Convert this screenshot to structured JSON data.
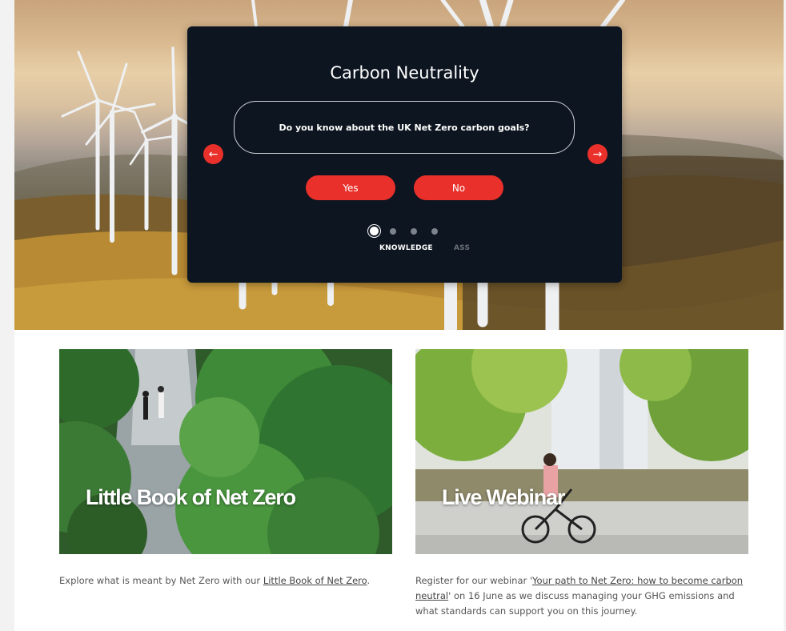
{
  "hero": {
    "modal": {
      "title": "Carbon Neutrality",
      "question": "Do you know about the UK Net Zero carbon goals?",
      "yes_label": "Yes",
      "no_label": "No",
      "prev_icon": "arrow-left-icon",
      "next_icon": "arrow-right-icon",
      "step_count": 4,
      "active_step": 1,
      "step_label_current": "KNOWLEDGE",
      "step_label_next": "ASS"
    }
  },
  "cards": [
    {
      "title": "Little Book of Net Zero",
      "text_before": "Explore what is meant by Net Zero with our ",
      "link_text": "Little Book of Net Zero",
      "text_after": "."
    },
    {
      "title": "Live Webinar",
      "text_before": "Register for our webinar '",
      "link_text": "Your path to Net Zero: how to become carbon neutral",
      "text_after": "' on 16 June as we discuss managing your GHG emissions and what standards can support you on this journey."
    }
  ],
  "colors": {
    "accent": "#e9302b",
    "modal_bg": "#0d1520",
    "page_bg": "#f2f2f2"
  }
}
